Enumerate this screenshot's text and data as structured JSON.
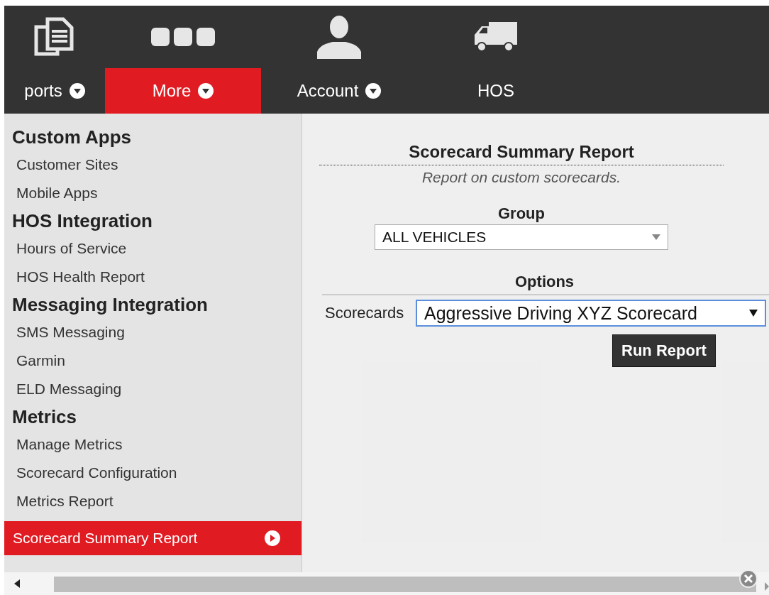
{
  "nav": [
    {
      "label": "ports",
      "dropdown": true,
      "selected": false
    },
    {
      "label": "More",
      "dropdown": true,
      "selected": true
    },
    {
      "label": "Account",
      "dropdown": true,
      "selected": false
    },
    {
      "label": "HOS",
      "dropdown": false,
      "selected": false
    }
  ],
  "menu": [
    {
      "heading": "Custom Apps",
      "items": [
        {
          "label": "Customer Sites",
          "selected": false
        },
        {
          "label": "Mobile Apps",
          "selected": false
        }
      ]
    },
    {
      "heading": "HOS Integration",
      "items": [
        {
          "label": "Hours of Service",
          "selected": false
        },
        {
          "label": "HOS Health Report",
          "selected": false
        }
      ]
    },
    {
      "heading": "Messaging Integration",
      "items": [
        {
          "label": "SMS Messaging",
          "selected": false
        },
        {
          "label": "Garmin",
          "selected": false
        },
        {
          "label": "ELD Messaging",
          "selected": false
        }
      ]
    },
    {
      "heading": "Metrics",
      "items": [
        {
          "label": "Manage Metrics",
          "selected": false
        },
        {
          "label": "Scorecard Configuration",
          "selected": false
        },
        {
          "label": "Metrics Report",
          "selected": false
        },
        {
          "label": "Scorecard Summary Report",
          "selected": true
        }
      ]
    }
  ],
  "report": {
    "title": "Scorecard Summary Report",
    "subtitle": "Report on custom scorecards.",
    "group_label": "Group",
    "group_value": "ALL VEHICLES",
    "options_label": "Options",
    "scorecards_label": "Scorecards",
    "scorecards_value": "Aggressive Driving XYZ Scorecard",
    "run_button": "Run Report"
  }
}
